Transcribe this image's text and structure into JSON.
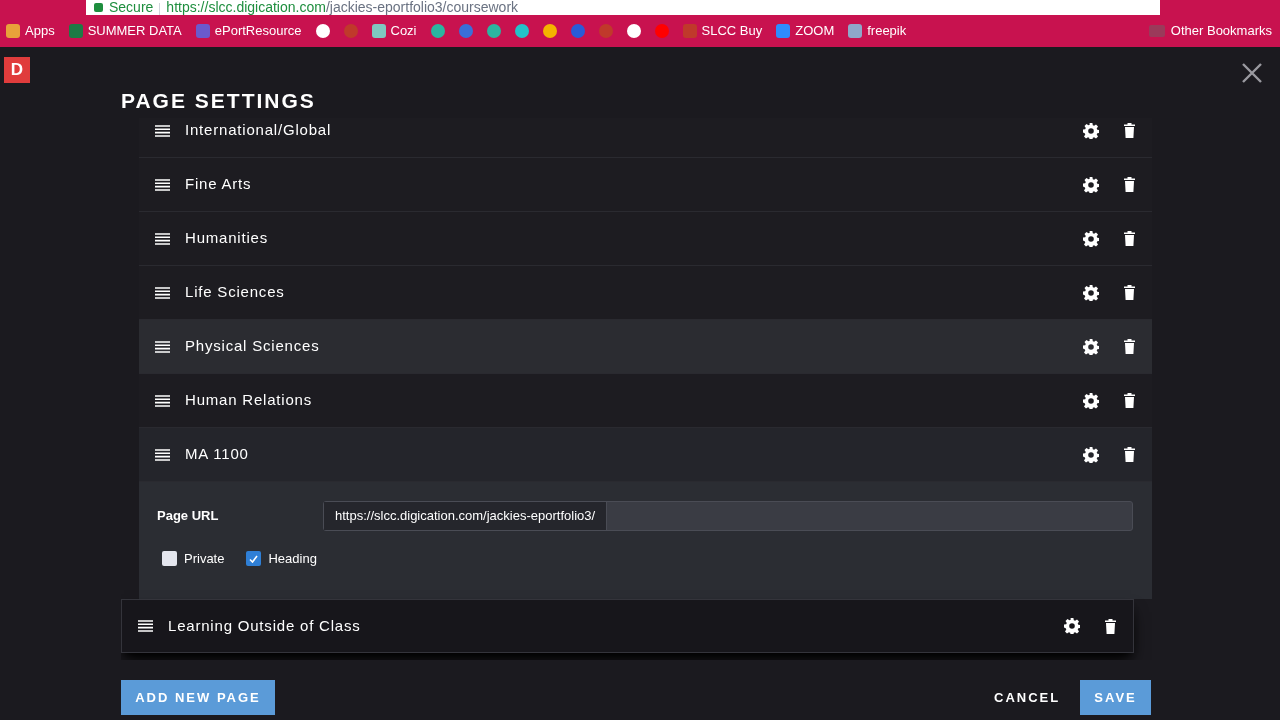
{
  "browser": {
    "secure_label": "Secure",
    "url_host": "https://slcc.digication.com",
    "url_path": "/jackies-eportfolio3/coursework",
    "bookmarks": [
      {
        "label": "Apps",
        "color": "#e8a23a"
      },
      {
        "label": "SUMMER DATA",
        "color": "#1e7a45"
      },
      {
        "label": "ePortResource",
        "color": "#6a5acd"
      },
      {
        "color": "#ffffff"
      },
      {
        "color": "#c0392b"
      },
      {
        "label": "Cozi",
        "color": "#7fc8c0"
      },
      {
        "color": "#2bb5a0"
      },
      {
        "color": "#3a6fd8"
      },
      {
        "color": "#2bb5a0"
      },
      {
        "color": "#24c2c9"
      },
      {
        "color": "#f4b400"
      },
      {
        "color": "#2a5bd7"
      },
      {
        "color": "#c0392b"
      },
      {
        "color": "#ffffff"
      },
      {
        "color": "#ff0000"
      },
      {
        "label": "SLCC Buy",
        "color": "#c0392b"
      },
      {
        "label": "ZOOM",
        "color": "#2d8cff"
      },
      {
        "label": "freepik",
        "color": "#8fa7c9"
      }
    ],
    "other_bookmarks": "Other Bookmarks"
  },
  "logo": "D",
  "title": "PAGE SETTINGS",
  "pages": [
    {
      "title": "International/Global",
      "highlighted": false,
      "dragging": false,
      "expanded": false
    },
    {
      "title": "Fine Arts",
      "highlighted": false,
      "dragging": false,
      "expanded": false
    },
    {
      "title": "Humanities",
      "highlighted": false,
      "dragging": false,
      "expanded": false
    },
    {
      "title": "Life Sciences",
      "highlighted": false,
      "dragging": false,
      "expanded": false
    },
    {
      "title": "Physical Sciences",
      "highlighted": true,
      "dragging": false,
      "expanded": false
    },
    {
      "title": "Human Relations",
      "highlighted": false,
      "dragging": false,
      "expanded": false
    },
    {
      "title": "MA 1100",
      "highlighted": false,
      "dragging": false,
      "expanded": true,
      "url_label": "Page URL",
      "url_prefix": "https://slcc.digication.com/jackies-eportfolio3/",
      "options": [
        {
          "label": "Private",
          "checked": false
        },
        {
          "label": "Heading",
          "checked": true
        }
      ]
    },
    {
      "title": "Learning Outside of Class",
      "highlighted": false,
      "dragging": true,
      "expanded": false
    }
  ],
  "buttons": {
    "add": "ADD NEW PAGE",
    "cancel": "CANCEL",
    "save": "SAVE"
  }
}
